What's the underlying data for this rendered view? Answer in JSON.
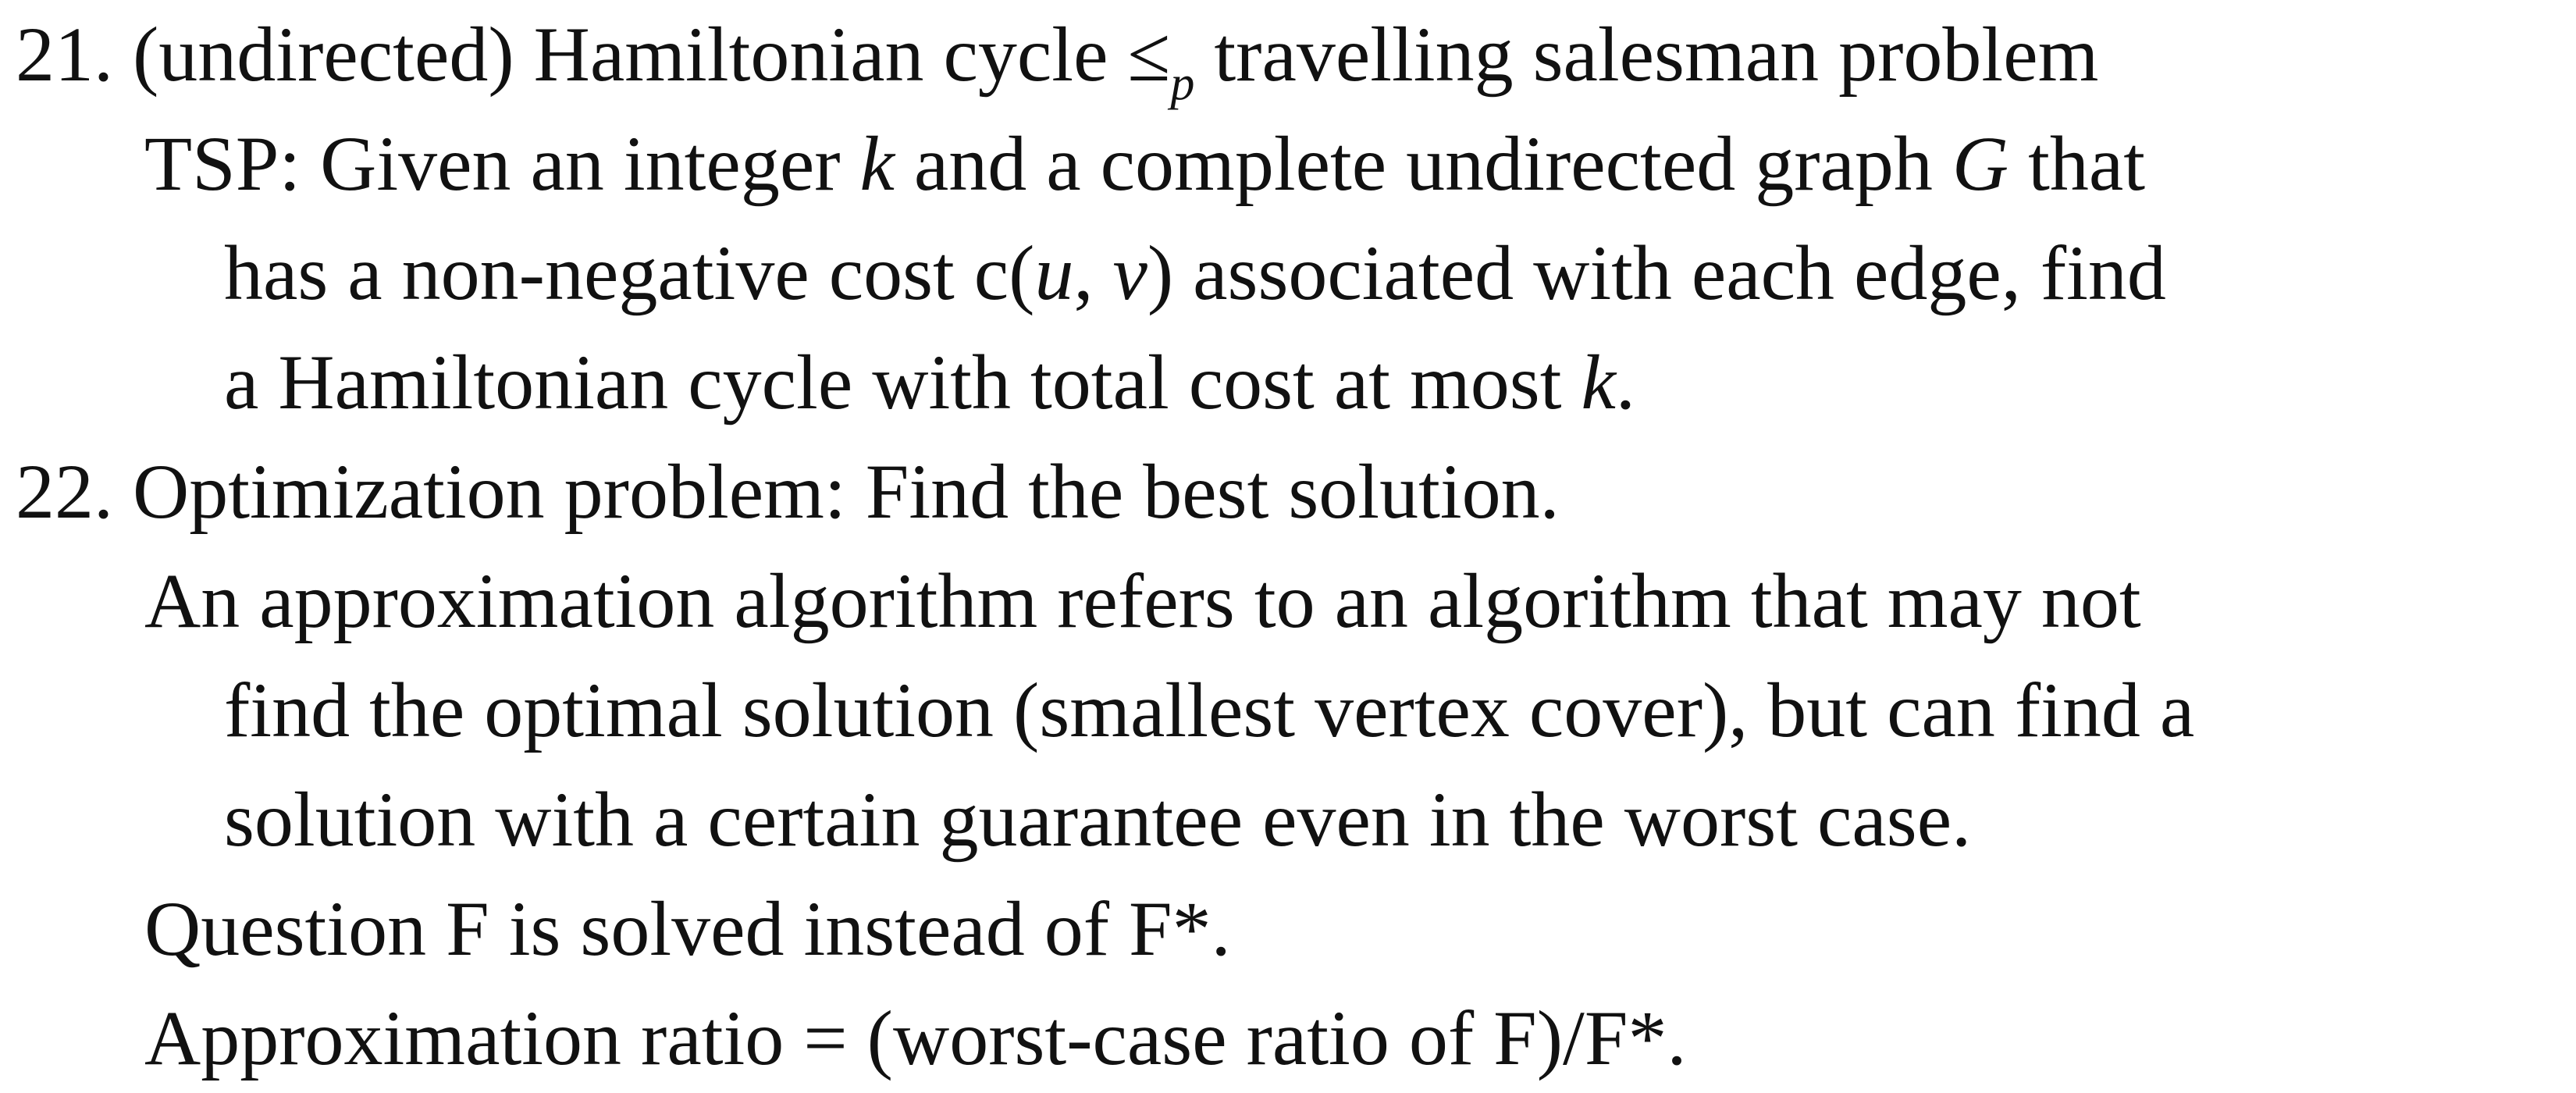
{
  "items": [
    {
      "number": "21.",
      "title": {
        "before": "(undirected) Hamiltonian cycle ≤",
        "sub": "p",
        "after": " travelling salesman problem"
      },
      "tsp_line1": {
        "a": "TSP: Given an integer ",
        "k": "k",
        "b": " and a complete undirected graph ",
        "G": "G",
        "c": " that"
      },
      "tsp_line2": {
        "a": "has a non-negative cost c(",
        "u": "u",
        "b": ", ",
        "v": "v",
        "c": ") associated with each edge, find"
      },
      "tsp_line3": {
        "a": "a Hamiltonian cycle with total cost at most ",
        "k": "k",
        "b": "."
      }
    },
    {
      "number": "22.",
      "title": "Optimization problem: Find the best solution.",
      "approx_lines": [
        "An approximation algorithm refers to an algorithm that may not",
        "find the optimal solution (smallest vertex cover), but can find a",
        "solution with a certain guarantee even in the worst case."
      ],
      "question_line": "Question F is solved instead of F*.",
      "ratio_line": "Approximation ratio = (worst-case ratio of F)/F*."
    }
  ]
}
